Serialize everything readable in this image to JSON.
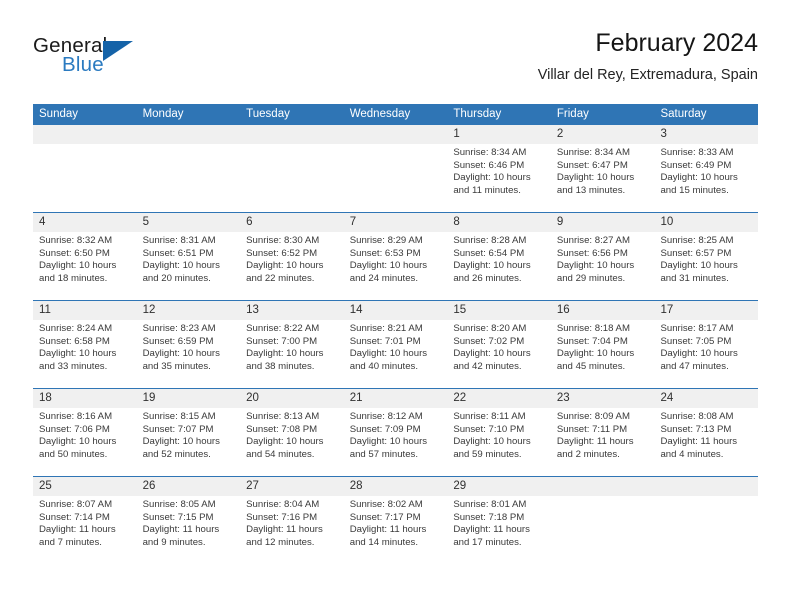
{
  "logo": {
    "word1": "General",
    "word2": "Blue",
    "triangle_color": "#1563a8",
    "blue_text_color": "#2a7ac0"
  },
  "header": {
    "title": "February 2024",
    "subtitle": "Villar del Rey, Extremadura, Spain"
  },
  "theme": {
    "header_blue": "#2f75b5",
    "daynum_band": "#f0f0f0",
    "separator_blue": "#2f75b5"
  },
  "calendar": {
    "day_names": [
      "Sunday",
      "Monday",
      "Tuesday",
      "Wednesday",
      "Thursday",
      "Friday",
      "Saturday"
    ],
    "weeks": [
      [
        {
          "day": "",
          "sunrise": "",
          "sunset": "",
          "daylight": "",
          "empty": true
        },
        {
          "day": "",
          "sunrise": "",
          "sunset": "",
          "daylight": "",
          "empty": true
        },
        {
          "day": "",
          "sunrise": "",
          "sunset": "",
          "daylight": "",
          "empty": true
        },
        {
          "day": "",
          "sunrise": "",
          "sunset": "",
          "daylight": "",
          "empty": true
        },
        {
          "day": "1",
          "sunrise": "Sunrise: 8:34 AM",
          "sunset": "Sunset: 6:46 PM",
          "daylight": "Daylight: 10 hours and 11 minutes."
        },
        {
          "day": "2",
          "sunrise": "Sunrise: 8:34 AM",
          "sunset": "Sunset: 6:47 PM",
          "daylight": "Daylight: 10 hours and 13 minutes."
        },
        {
          "day": "3",
          "sunrise": "Sunrise: 8:33 AM",
          "sunset": "Sunset: 6:49 PM",
          "daylight": "Daylight: 10 hours and 15 minutes."
        }
      ],
      [
        {
          "day": "4",
          "sunrise": "Sunrise: 8:32 AM",
          "sunset": "Sunset: 6:50 PM",
          "daylight": "Daylight: 10 hours and 18 minutes."
        },
        {
          "day": "5",
          "sunrise": "Sunrise: 8:31 AM",
          "sunset": "Sunset: 6:51 PM",
          "daylight": "Daylight: 10 hours and 20 minutes."
        },
        {
          "day": "6",
          "sunrise": "Sunrise: 8:30 AM",
          "sunset": "Sunset: 6:52 PM",
          "daylight": "Daylight: 10 hours and 22 minutes."
        },
        {
          "day": "7",
          "sunrise": "Sunrise: 8:29 AM",
          "sunset": "Sunset: 6:53 PM",
          "daylight": "Daylight: 10 hours and 24 minutes."
        },
        {
          "day": "8",
          "sunrise": "Sunrise: 8:28 AM",
          "sunset": "Sunset: 6:54 PM",
          "daylight": "Daylight: 10 hours and 26 minutes."
        },
        {
          "day": "9",
          "sunrise": "Sunrise: 8:27 AM",
          "sunset": "Sunset: 6:56 PM",
          "daylight": "Daylight: 10 hours and 29 minutes."
        },
        {
          "day": "10",
          "sunrise": "Sunrise: 8:25 AM",
          "sunset": "Sunset: 6:57 PM",
          "daylight": "Daylight: 10 hours and 31 minutes."
        }
      ],
      [
        {
          "day": "11",
          "sunrise": "Sunrise: 8:24 AM",
          "sunset": "Sunset: 6:58 PM",
          "daylight": "Daylight: 10 hours and 33 minutes."
        },
        {
          "day": "12",
          "sunrise": "Sunrise: 8:23 AM",
          "sunset": "Sunset: 6:59 PM",
          "daylight": "Daylight: 10 hours and 35 minutes."
        },
        {
          "day": "13",
          "sunrise": "Sunrise: 8:22 AM",
          "sunset": "Sunset: 7:00 PM",
          "daylight": "Daylight: 10 hours and 38 minutes."
        },
        {
          "day": "14",
          "sunrise": "Sunrise: 8:21 AM",
          "sunset": "Sunset: 7:01 PM",
          "daylight": "Daylight: 10 hours and 40 minutes."
        },
        {
          "day": "15",
          "sunrise": "Sunrise: 8:20 AM",
          "sunset": "Sunset: 7:02 PM",
          "daylight": "Daylight: 10 hours and 42 minutes."
        },
        {
          "day": "16",
          "sunrise": "Sunrise: 8:18 AM",
          "sunset": "Sunset: 7:04 PM",
          "daylight": "Daylight: 10 hours and 45 minutes."
        },
        {
          "day": "17",
          "sunrise": "Sunrise: 8:17 AM",
          "sunset": "Sunset: 7:05 PM",
          "daylight": "Daylight: 10 hours and 47 minutes."
        }
      ],
      [
        {
          "day": "18",
          "sunrise": "Sunrise: 8:16 AM",
          "sunset": "Sunset: 7:06 PM",
          "daylight": "Daylight: 10 hours and 50 minutes."
        },
        {
          "day": "19",
          "sunrise": "Sunrise: 8:15 AM",
          "sunset": "Sunset: 7:07 PM",
          "daylight": "Daylight: 10 hours and 52 minutes."
        },
        {
          "day": "20",
          "sunrise": "Sunrise: 8:13 AM",
          "sunset": "Sunset: 7:08 PM",
          "daylight": "Daylight: 10 hours and 54 minutes."
        },
        {
          "day": "21",
          "sunrise": "Sunrise: 8:12 AM",
          "sunset": "Sunset: 7:09 PM",
          "daylight": "Daylight: 10 hours and 57 minutes."
        },
        {
          "day": "22",
          "sunrise": "Sunrise: 8:11 AM",
          "sunset": "Sunset: 7:10 PM",
          "daylight": "Daylight: 10 hours and 59 minutes."
        },
        {
          "day": "23",
          "sunrise": "Sunrise: 8:09 AM",
          "sunset": "Sunset: 7:11 PM",
          "daylight": "Daylight: 11 hours and 2 minutes."
        },
        {
          "day": "24",
          "sunrise": "Sunrise: 8:08 AM",
          "sunset": "Sunset: 7:13 PM",
          "daylight": "Daylight: 11 hours and 4 minutes."
        }
      ],
      [
        {
          "day": "25",
          "sunrise": "Sunrise: 8:07 AM",
          "sunset": "Sunset: 7:14 PM",
          "daylight": "Daylight: 11 hours and 7 minutes."
        },
        {
          "day": "26",
          "sunrise": "Sunrise: 8:05 AM",
          "sunset": "Sunset: 7:15 PM",
          "daylight": "Daylight: 11 hours and 9 minutes."
        },
        {
          "day": "27",
          "sunrise": "Sunrise: 8:04 AM",
          "sunset": "Sunset: 7:16 PM",
          "daylight": "Daylight: 11 hours and 12 minutes."
        },
        {
          "day": "28",
          "sunrise": "Sunrise: 8:02 AM",
          "sunset": "Sunset: 7:17 PM",
          "daylight": "Daylight: 11 hours and 14 minutes."
        },
        {
          "day": "29",
          "sunrise": "Sunrise: 8:01 AM",
          "sunset": "Sunset: 7:18 PM",
          "daylight": "Daylight: 11 hours and 17 minutes."
        },
        {
          "day": "",
          "sunrise": "",
          "sunset": "",
          "daylight": "",
          "empty": true
        },
        {
          "day": "",
          "sunrise": "",
          "sunset": "",
          "daylight": "",
          "empty": true
        }
      ]
    ]
  }
}
